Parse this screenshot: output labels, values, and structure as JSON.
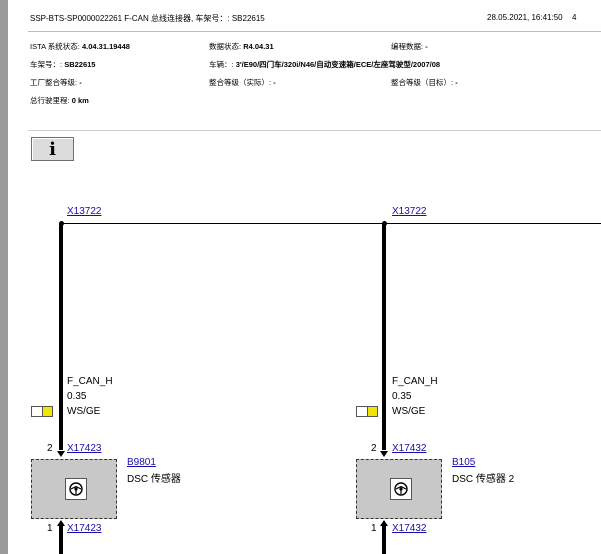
{
  "header": {
    "title": "SSP-BTS-SP0000022261 F-CAN 总线连接器, 车架号：: SB22615",
    "date": "28.05.2021, 16:41:50",
    "page": "4"
  },
  "meta": {
    "istas_label": "ISTA 系统状态:",
    "istas_value": "4.04.31.19448",
    "datastatus_label": "数据状态:",
    "datastatus_value": "R4.04.31",
    "prog_label": "编程数据:",
    "prog_value": "-",
    "vin_label": "车架号：:",
    "vin_value": "SB22615",
    "vehicle_label": "车辆：:",
    "vehicle_value": "3'/E90/四门车/320i/N46/自动变速箱/ECE/左座驾驶型/2007/08",
    "factory_label": "工厂整合等级:",
    "factory_value": "-",
    "int_actual_label": "整合等级（实际）:",
    "int_actual_value": "-",
    "int_target_label": "整合等级（目标）:",
    "int_target_value": "-",
    "mileage_label": "总行驶里程:",
    "mileage_value": "0 km"
  },
  "info_button": {
    "label": "i"
  },
  "diagram": {
    "left": {
      "top_connector": "X13722",
      "signal": "F_CAN_H",
      "gauge": "0.35",
      "color_code": "WS/GE",
      "upper_pin": "2",
      "upper_connector": "X17423",
      "component_id": "B9801",
      "component_name": "DSC 传感器",
      "lower_pin": "1",
      "lower_connector": "X17423"
    },
    "right": {
      "top_connector": "X13722",
      "signal": "F_CAN_H",
      "gauge": "0.35",
      "color_code": "WS/GE",
      "upper_pin": "2",
      "upper_connector": "X17432",
      "component_id": "B105",
      "component_name": "DSC 传感器 2",
      "lower_pin": "1",
      "lower_connector": "X17432"
    },
    "colors": {
      "wire": "#000000",
      "link": "#1a0dab",
      "yellow": "#f2e600",
      "component_fill": "#c8c8c8"
    }
  }
}
